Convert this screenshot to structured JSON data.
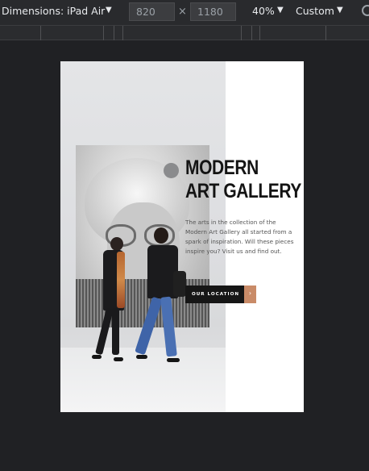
{
  "toolbar": {
    "dimensions_label": "Dimensions: iPad Air",
    "width_value": "820",
    "times_symbol": "×",
    "height_value": "1180",
    "zoom_label": "40%",
    "preset_label": "Custom",
    "caret_glyph": "▼",
    "rotate_icon": "rotate-icon"
  },
  "page": {
    "heading_line1": "MODERN",
    "heading_line2": "ART GALLERY",
    "description": "The arts in the collection of the Modern Art Gallery all started from a spark of inspiration. Will these pieces inspire you? Visit us and find out.",
    "cta_label": "OUR LOCATION",
    "cta_arrow": "›",
    "accent_color": "#c98b68"
  }
}
